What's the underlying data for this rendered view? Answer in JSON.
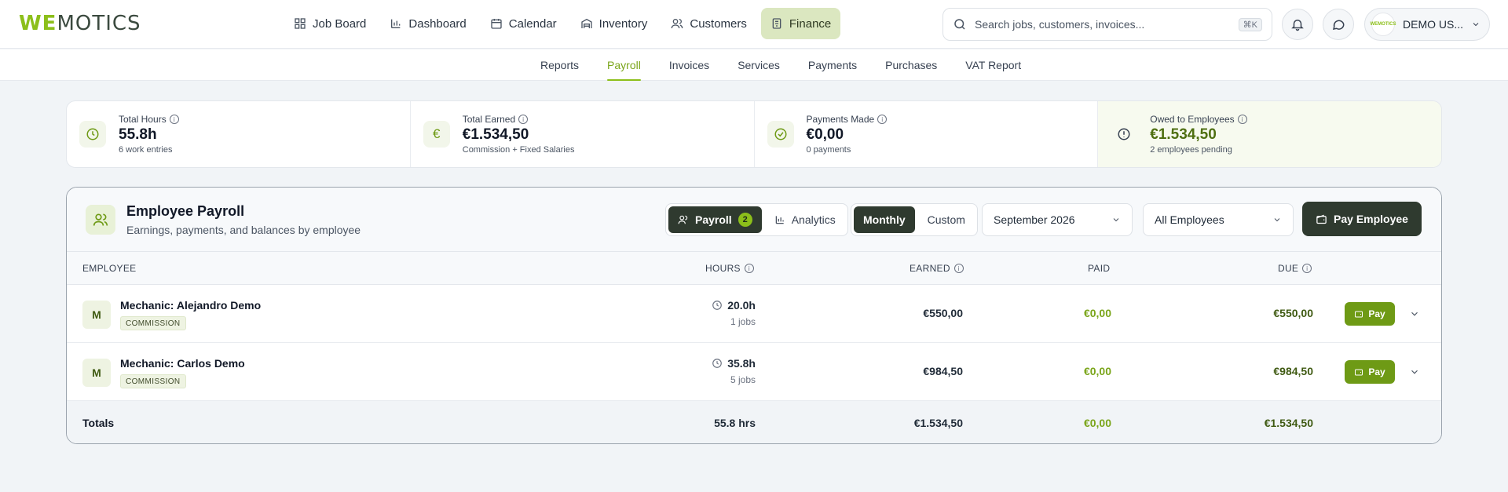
{
  "brand": {
    "logo_we": "WE",
    "logo_rest": "MOTICS"
  },
  "nav": [
    {
      "label": "Job Board",
      "icon": "grid-icon"
    },
    {
      "label": "Dashboard",
      "icon": "bar-chart-icon"
    },
    {
      "label": "Calendar",
      "icon": "calendar-icon"
    },
    {
      "label": "Inventory",
      "icon": "warehouse-icon"
    },
    {
      "label": "Customers",
      "icon": "users-icon"
    },
    {
      "label": "Finance",
      "icon": "receipt-icon",
      "active": true
    }
  ],
  "search": {
    "placeholder": "Search jobs, customers, invoices...",
    "shortcut": "⌘K"
  },
  "user": {
    "name": "DEMO US...",
    "avatar_text": "WEMOTICS"
  },
  "subnav": [
    "Reports",
    "Payroll",
    "Invoices",
    "Services",
    "Payments",
    "Purchases",
    "VAT Report"
  ],
  "subnav_active": "Payroll",
  "stats": [
    {
      "label": "Total Hours",
      "value": "55.8h",
      "sub": "6 work entries",
      "icon": "clock-icon"
    },
    {
      "label": "Total Earned",
      "value": "€1.534,50",
      "sub": "Commission + Fixed Salaries",
      "icon": "euro-icon"
    },
    {
      "label": "Payments Made",
      "value": "€0,00",
      "sub": "0 payments",
      "icon": "check-circle-icon"
    },
    {
      "label": "Owed to Employees",
      "value": "€1.534,50",
      "sub": "2 employees pending",
      "icon": "alert-circle-icon"
    }
  ],
  "payroll": {
    "title": "Employee Payroll",
    "subtitle": "Earnings, payments, and balances by employee",
    "view_tabs": [
      {
        "label": "Payroll",
        "badge": "2",
        "active": true
      },
      {
        "label": "Analytics"
      }
    ],
    "period_tabs": [
      {
        "label": "Monthly",
        "active": true
      },
      {
        "label": "Custom"
      }
    ],
    "month": "September 2026",
    "employee_filter": "All Employees",
    "pay_button": "Pay Employee",
    "columns": {
      "employee": "EMPLOYEE",
      "hours": "HOURS",
      "earned": "EARNED",
      "paid": "PAID",
      "due": "DUE"
    },
    "rows": [
      {
        "initial": "M",
        "name": "Mechanic: Alejandro Demo",
        "tag": "COMMISSION",
        "hours": "20.0h",
        "jobs": "1 jobs",
        "earned": "€550,00",
        "paid": "€0,00",
        "due": "€550,00",
        "pay": "Pay"
      },
      {
        "initial": "M",
        "name": "Mechanic: Carlos Demo",
        "tag": "COMMISSION",
        "hours": "35.8h",
        "jobs": "5 jobs",
        "earned": "€984,50",
        "paid": "€0,00",
        "due": "€984,50",
        "pay": "Pay"
      }
    ],
    "totals": {
      "label": "Totals",
      "hours": "55.8 hrs",
      "earned": "€1.534,50",
      "paid": "€0,00",
      "due": "€1.534,50"
    }
  },
  "colors": {
    "accent": "#8cbf1a",
    "dark": "#2f3a2f",
    "finance_bg": "#dbe7c0"
  }
}
